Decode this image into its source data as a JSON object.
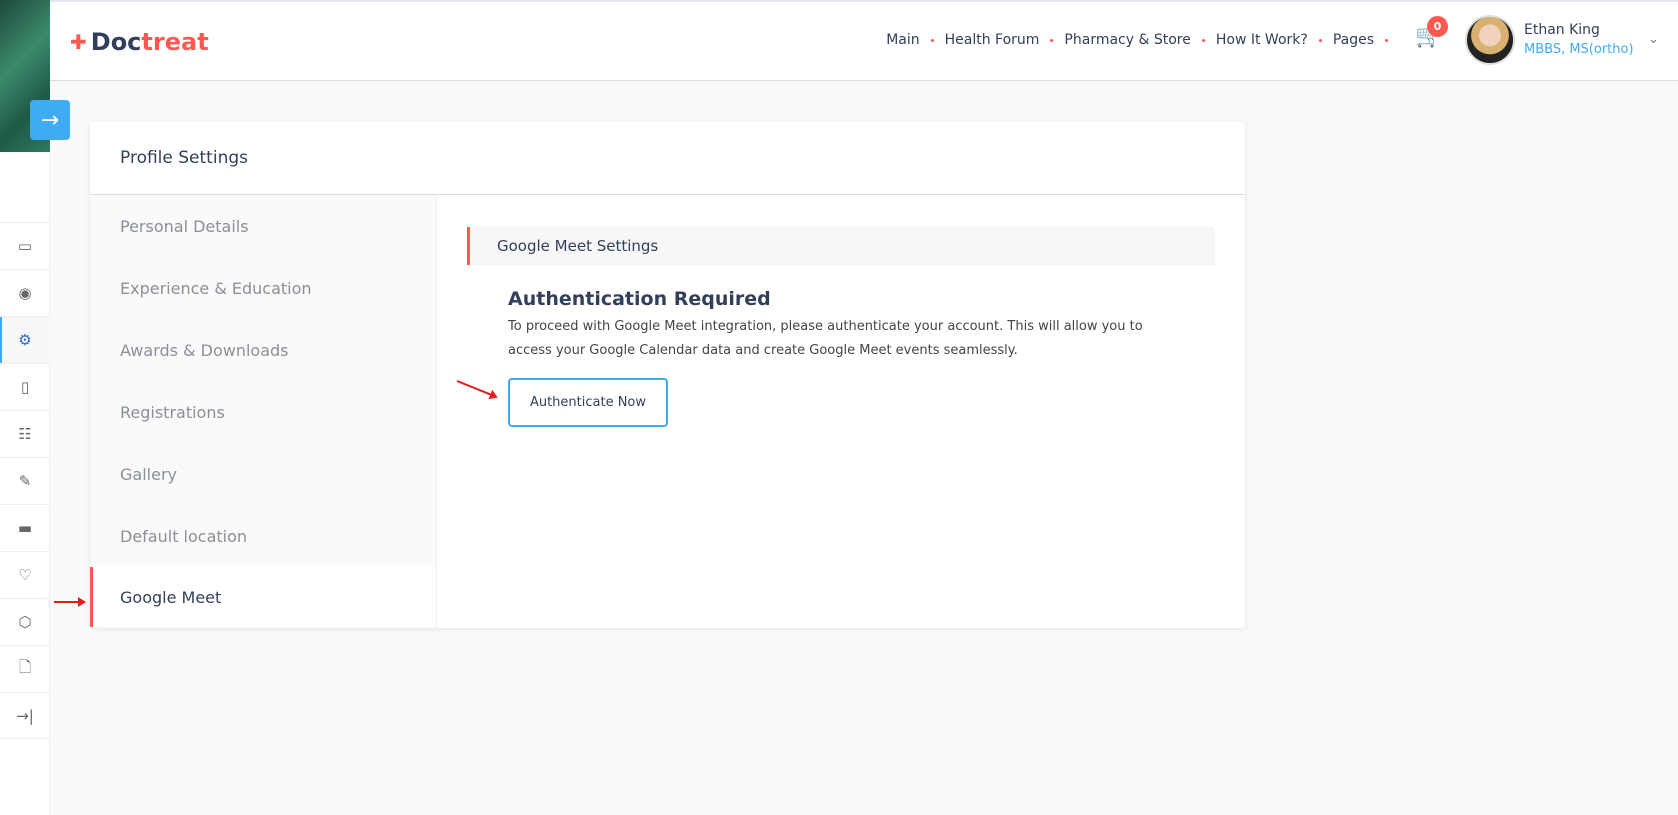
{
  "brand": {
    "part1": "Doc",
    "part2": "treat"
  },
  "nav": {
    "items": [
      "Main",
      "Health Forum",
      "Pharmacy & Store",
      "How It Work?",
      "Pages"
    ]
  },
  "cart": {
    "count": "0"
  },
  "user": {
    "name": "Ethan King",
    "role": "MBBS, MS(ortho)"
  },
  "sidebar": {
    "icons": [
      "monitor-icon",
      "eye-icon",
      "gear-icon",
      "calendar-icon",
      "sliders-icon",
      "edit-icon",
      "card-icon",
      "heart-icon",
      "box-icon",
      "file-icon",
      "logout-icon"
    ]
  },
  "card": {
    "title": "Profile Settings",
    "menu": [
      "Personal Details",
      "Experience & Education",
      "Awards & Downloads",
      "Registrations",
      "Gallery",
      "Default location",
      "Google Meet"
    ]
  },
  "panel": {
    "section_title": "Google Meet Settings",
    "heading": "Authentication Required",
    "text": "To proceed with Google Meet integration, please authenticate your account. This will allow you to access your Google Calendar data and create Google Meet events seamlessly.",
    "button": "Authenticate Now"
  },
  "colors": {
    "accent": "#ff5851",
    "blue": "#3fabf2",
    "dark": "#323f5a"
  }
}
